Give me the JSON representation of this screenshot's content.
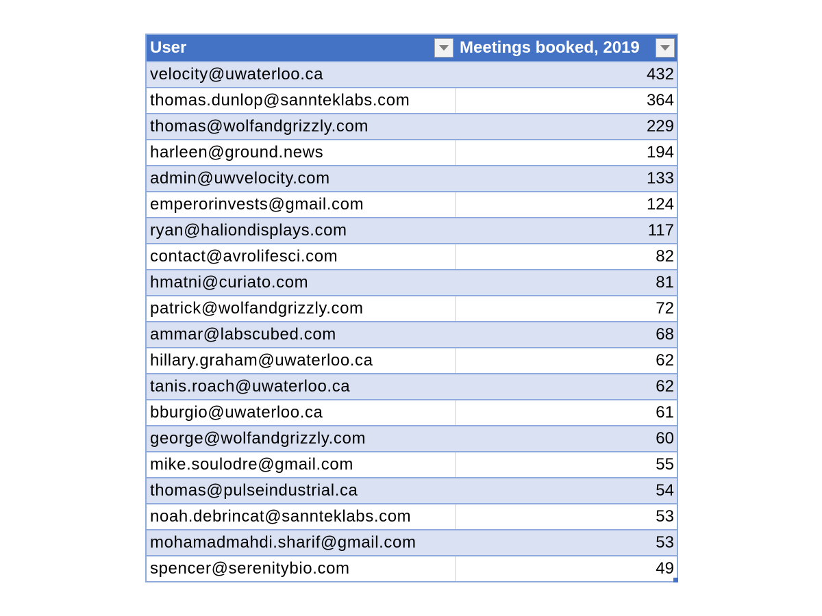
{
  "table": {
    "header": {
      "user_label": "User",
      "meetings_label": "Meetings booked, 2019",
      "filter_icon": "chevron-down-icon"
    },
    "rows": [
      {
        "user": "velocity@uwaterloo.ca",
        "meetings": "432"
      },
      {
        "user": "thomas.dunlop@sannteklabs.com",
        "meetings": "364"
      },
      {
        "user": "thomas@wolfandgrizzly.com",
        "meetings": "229"
      },
      {
        "user": "harleen@ground.news",
        "meetings": "194"
      },
      {
        "user": "admin@uwvelocity.com",
        "meetings": "133"
      },
      {
        "user": "emperorinvests@gmail.com",
        "meetings": "124"
      },
      {
        "user": "ryan@haliondisplays.com",
        "meetings": "117"
      },
      {
        "user": "contact@avrolifesci.com",
        "meetings": "82"
      },
      {
        "user": "hmatni@curiato.com",
        "meetings": "81"
      },
      {
        "user": "patrick@wolfandgrizzly.com",
        "meetings": "72"
      },
      {
        "user": "ammar@labscubed.com",
        "meetings": "68"
      },
      {
        "user": "hillary.graham@uwaterloo.ca",
        "meetings": "62"
      },
      {
        "user": "tanis.roach@uwaterloo.ca",
        "meetings": "62"
      },
      {
        "user": "bburgio@uwaterloo.ca",
        "meetings": "61"
      },
      {
        "user": "george@wolfandgrizzly.com",
        "meetings": "60"
      },
      {
        "user": "mike.soulodre@gmail.com",
        "meetings": "55"
      },
      {
        "user": "thomas@pulseindustrial.ca",
        "meetings": "54"
      },
      {
        "user": "noah.debrincat@sannteklabs.com",
        "meetings": "53"
      },
      {
        "user": "mohamadmahdi.sharif@gmail.com",
        "meetings": "53"
      },
      {
        "user": "spencer@serenitybio.com",
        "meetings": "49"
      }
    ],
    "colors": {
      "header_bg": "#4472C4",
      "band_bg": "#D9E1F2",
      "border": "#8EA9DB"
    }
  }
}
